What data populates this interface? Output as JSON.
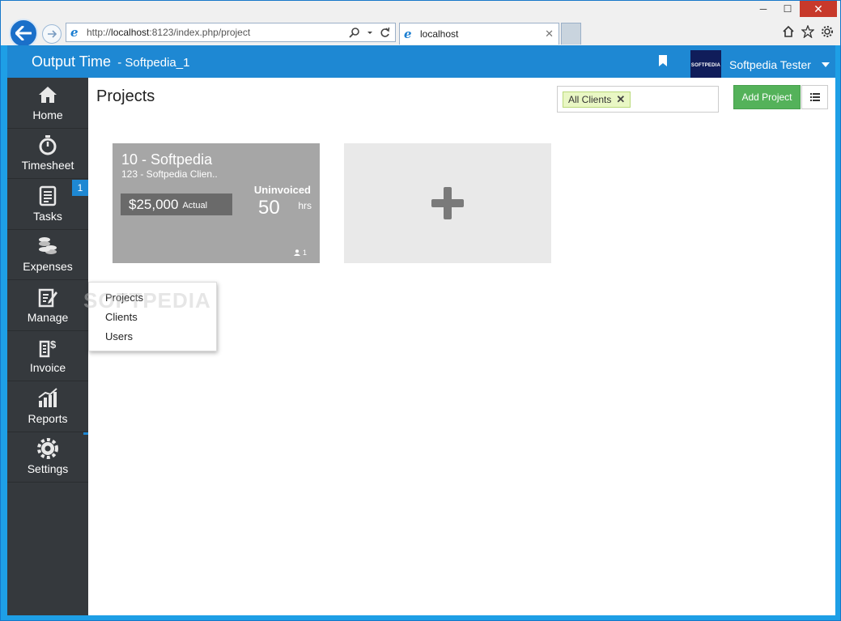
{
  "browser": {
    "url_prefix": "http://",
    "url_host": "localhost",
    "url_rest": ":8123/index.php/project",
    "tab_title": "localhost",
    "window_controls": {
      "minimize": "─",
      "maximize": "☐",
      "close": "✕"
    }
  },
  "header": {
    "app_name": "Output Time",
    "separator": " - ",
    "workspace": "Softpedia_1",
    "user_name": "Softpedia Tester",
    "user_logo_text": "SOFTPEDIA"
  },
  "sidebar": {
    "items": [
      {
        "label": "Home",
        "icon": "home-icon"
      },
      {
        "label": "Timesheet",
        "icon": "stopwatch-icon"
      },
      {
        "label": "Tasks",
        "icon": "tasks-icon",
        "badge": "1"
      },
      {
        "label": "Expenses",
        "icon": "coins-icon"
      },
      {
        "label": "Manage",
        "icon": "manage-icon"
      },
      {
        "label": "Invoice",
        "icon": "invoice-icon"
      },
      {
        "label": "Reports",
        "icon": "reports-icon"
      },
      {
        "label": "Settings",
        "icon": "gear-icon"
      }
    ]
  },
  "main": {
    "title": "Projects",
    "filter_chip": "All Clients",
    "add_project_label": "Add Project"
  },
  "project_card": {
    "title": "10 - Softpedia",
    "client": "123 - Softpedia Clien..",
    "amount": "$25,000",
    "amount_label": "Actual",
    "uninvoiced_label": "Uninvoiced",
    "hours": "50",
    "hours_unit": "hrs",
    "member_count": "1"
  },
  "manage_menu": {
    "items": [
      "Projects",
      "Clients",
      "Users"
    ]
  },
  "watermark": "SOFTPEDIA",
  "colors": {
    "header_blue": "#1e88d3",
    "sidebar": "#35393d",
    "add_button_green": "#54b25a",
    "card_gray": "#a6a6a6"
  }
}
